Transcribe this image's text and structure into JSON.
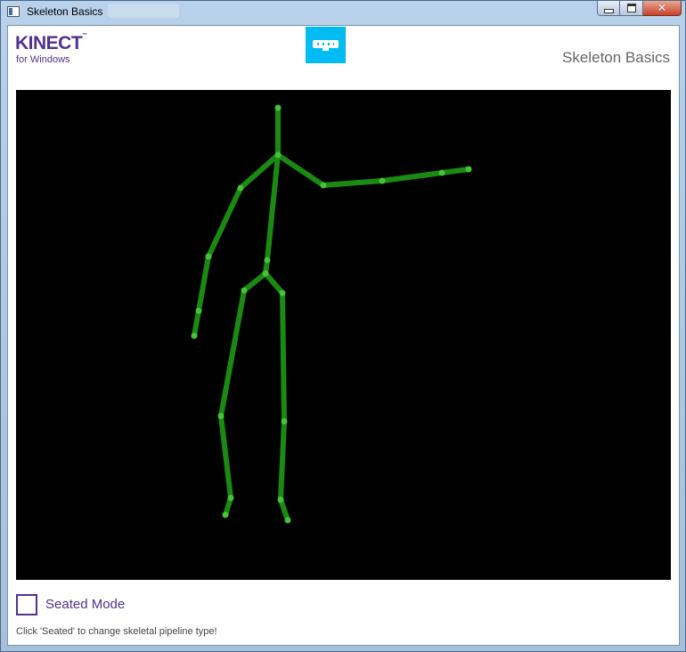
{
  "window": {
    "title": "Skeleton Basics"
  },
  "header": {
    "logo_main": "KINECT",
    "logo_tm": "™",
    "logo_sub": "for Windows",
    "title": "Skeleton Basics"
  },
  "seated_mode": {
    "label": "Seated Mode",
    "checked": false
  },
  "status_text": "Click 'Seated' to change skeletal pipeline type!",
  "colors": {
    "brand_purple": "#52318f",
    "sensor_blue": "#00bcf2",
    "bone": "#1a8a12",
    "joint": "#44c336",
    "background": "#000000"
  },
  "icons": [
    "kinect-sensor-icon",
    "app-window-icon"
  ]
}
